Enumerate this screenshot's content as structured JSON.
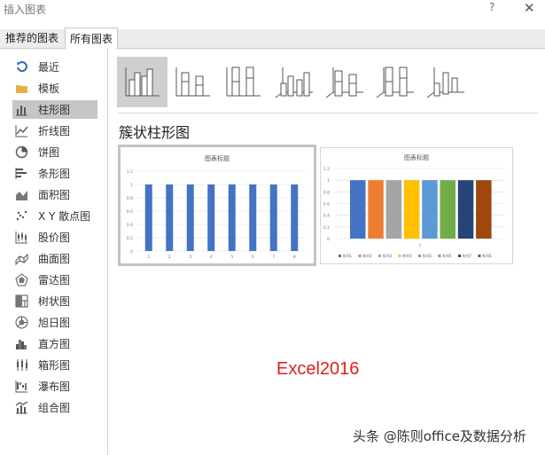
{
  "window": {
    "title": "插入图表",
    "help": "?",
    "close": "✕"
  },
  "tabs": [
    {
      "label": "推荐的图表"
    },
    {
      "label": "所有图表"
    }
  ],
  "sidebar": {
    "items": [
      {
        "label": "最近",
        "icon": "recent-icon"
      },
      {
        "label": "模板",
        "icon": "folder-icon"
      },
      {
        "label": "柱形图",
        "icon": "column-chart-icon",
        "selected": true
      },
      {
        "label": "折线图",
        "icon": "line-chart-icon"
      },
      {
        "label": "饼图",
        "icon": "pie-chart-icon"
      },
      {
        "label": "条形图",
        "icon": "bar-chart-icon"
      },
      {
        "label": "面积图",
        "icon": "area-chart-icon"
      },
      {
        "label": "X Y 散点图",
        "icon": "scatter-chart-icon"
      },
      {
        "label": "股价图",
        "icon": "stock-chart-icon"
      },
      {
        "label": "曲面图",
        "icon": "surface-chart-icon"
      },
      {
        "label": "雷达图",
        "icon": "radar-chart-icon"
      },
      {
        "label": "树状图",
        "icon": "treemap-chart-icon"
      },
      {
        "label": "旭日图",
        "icon": "sunburst-chart-icon"
      },
      {
        "label": "直方图",
        "icon": "histogram-chart-icon"
      },
      {
        "label": "箱形图",
        "icon": "box-whisker-chart-icon"
      },
      {
        "label": "瀑布图",
        "icon": "waterfall-chart-icon"
      },
      {
        "label": "组合图",
        "icon": "combo-chart-icon"
      }
    ]
  },
  "subtypes": [
    "clustered",
    "stacked",
    "percent",
    "3d-clustered",
    "3d-stacked",
    "3d-percent",
    "3d-column"
  ],
  "main": {
    "heading": "簇状柱形图"
  },
  "previews": [
    {
      "title": "图表标题",
      "chart_data": {
        "type": "bar",
        "categories": [
          "1",
          "2",
          "3",
          "4",
          "5",
          "6",
          "7",
          "8"
        ],
        "values": [
          1,
          1,
          1,
          1,
          1,
          1,
          1,
          1
        ],
        "ylim": [
          0,
          1.2
        ],
        "yticks": [
          "0",
          "0.2",
          "0.4",
          "0.6",
          "0.8",
          "1",
          "1.2"
        ],
        "color": "#4472C4"
      }
    },
    {
      "title": "图表标题",
      "chart_data": {
        "type": "bar",
        "categories": [
          "1"
        ],
        "series": [
          {
            "name": "系列1",
            "color": "#4472C4",
            "value": 1
          },
          {
            "name": "系列2",
            "color": "#ED7D31",
            "value": 1
          },
          {
            "name": "系列3",
            "color": "#A5A5A5",
            "value": 1
          },
          {
            "name": "系列4",
            "color": "#FFC000",
            "value": 1
          },
          {
            "name": "系列5",
            "color": "#5B9BD5",
            "value": 1
          },
          {
            "name": "系列6",
            "color": "#70AD47",
            "value": 1
          },
          {
            "name": "系列7",
            "color": "#264478",
            "value": 1
          },
          {
            "name": "系列8",
            "color": "#9E480E",
            "value": 1
          }
        ],
        "ylim": [
          0,
          1.2
        ],
        "yticks": [
          "0",
          "0.2",
          "0.4",
          "0.6",
          "0.8",
          "1",
          "1.2"
        ]
      }
    }
  ],
  "overlay": {
    "watermark": "Excel2016",
    "credit": "头条 @陈则office及数据分析"
  }
}
